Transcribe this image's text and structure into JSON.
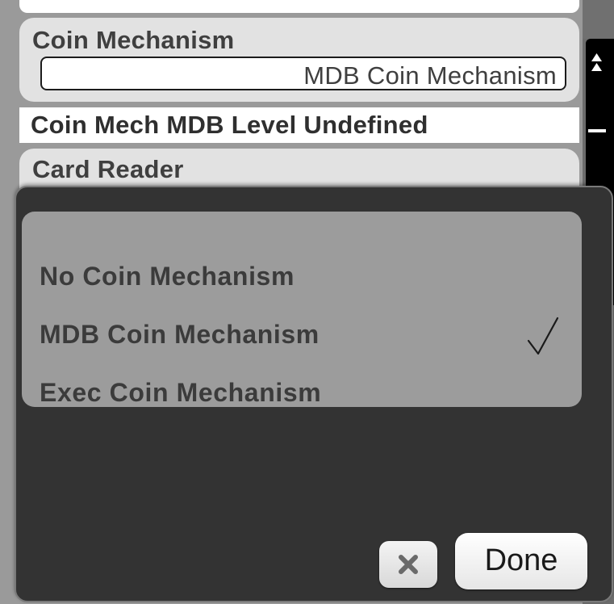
{
  "settings": {
    "coin_mechanism": {
      "label": "Coin Mechanism",
      "value": "MDB Coin Mechanism"
    },
    "status_text": "Coin Mech MDB Level Undefined",
    "card_reader": {
      "label": "Card Reader"
    }
  },
  "scrollbar": {
    "up_icon": "double-up-arrow-icon",
    "line_icon": "dash-icon"
  },
  "picker": {
    "options": [
      {
        "label": "No Coin Mechanism",
        "selected": false
      },
      {
        "label": "MDB Coin Mechanism",
        "selected": true
      },
      {
        "label": "Exec Coin Mechanism",
        "selected": false
      }
    ],
    "check_icon": "checkmark-icon",
    "close_icon": "x-icon",
    "done_label": "Done"
  },
  "colors": {
    "popup_background": "#333333",
    "options_background": "#9c9c9c",
    "card_background": "#e2e2e2",
    "text": "#3f3f3f"
  }
}
